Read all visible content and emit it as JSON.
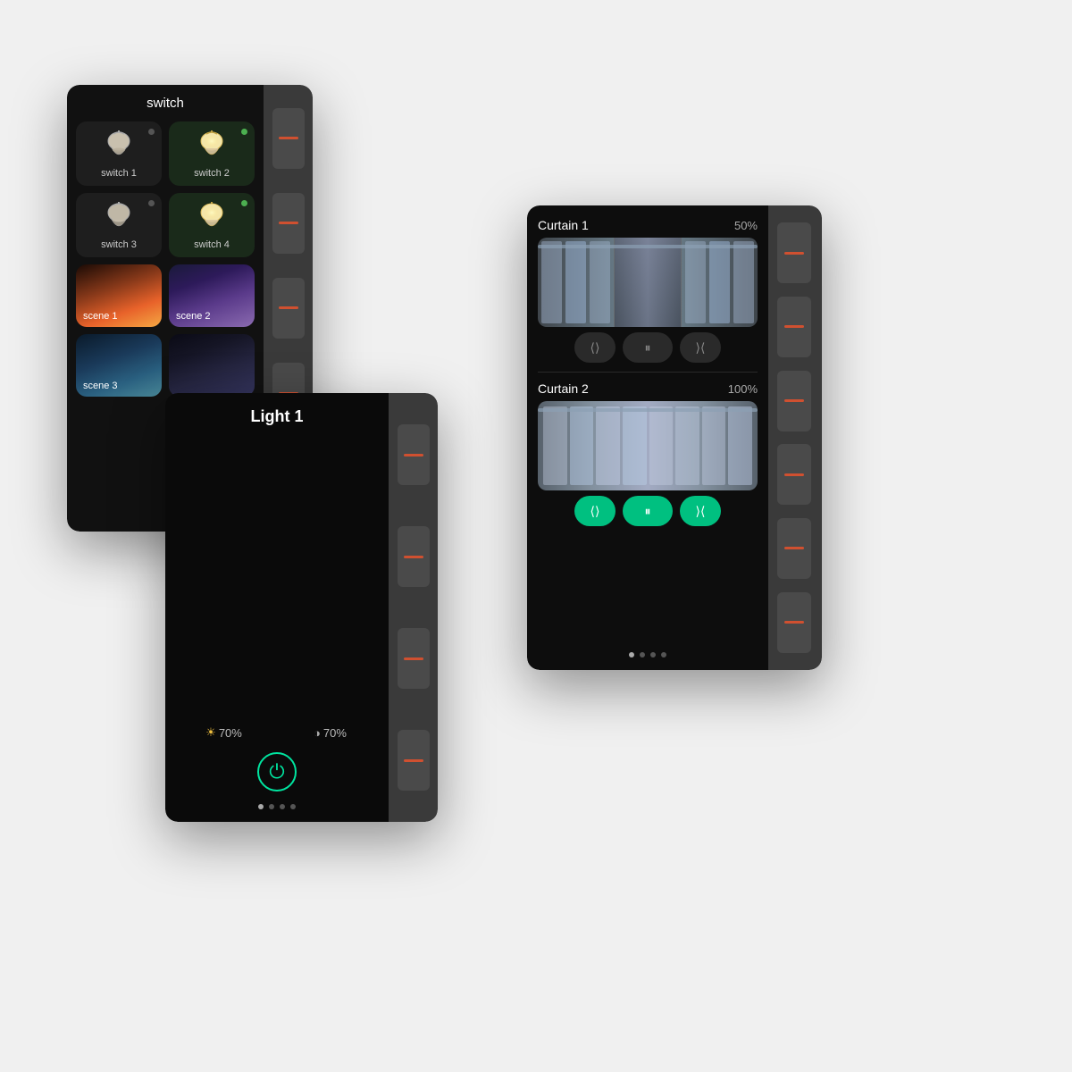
{
  "device_switch": {
    "title": "switch",
    "buttons": [
      {
        "label": "switch 1",
        "on": false
      },
      {
        "label": "switch 2",
        "on": true
      },
      {
        "label": "switch 3",
        "on": false
      },
      {
        "label": "switch 4",
        "on": true
      }
    ],
    "scenes": [
      {
        "label": "scene 1"
      },
      {
        "label": "scene 2"
      },
      {
        "label": "scene 3"
      }
    ],
    "hw_buttons": 5
  },
  "device_light": {
    "title": "Light 1",
    "brightness": "70%",
    "color_temp": "70%",
    "brightness_label": "70%",
    "color_temp_label": "70%",
    "page_dots": 4,
    "active_dot": 0,
    "hw_buttons": 4
  },
  "device_curtain": {
    "curtain1": {
      "name": "Curtain 1",
      "percent": "50%"
    },
    "curtain2": {
      "name": "Curtain 2",
      "percent": "100%"
    },
    "controls_inactive": [
      "⟨⟩",
      "⏸",
      "⟨⟩"
    ],
    "controls_active": [
      "⟨⟩",
      "⏸",
      "⟨⟩"
    ],
    "page_dots": 4,
    "active_dot": 0,
    "hw_buttons": 6
  }
}
